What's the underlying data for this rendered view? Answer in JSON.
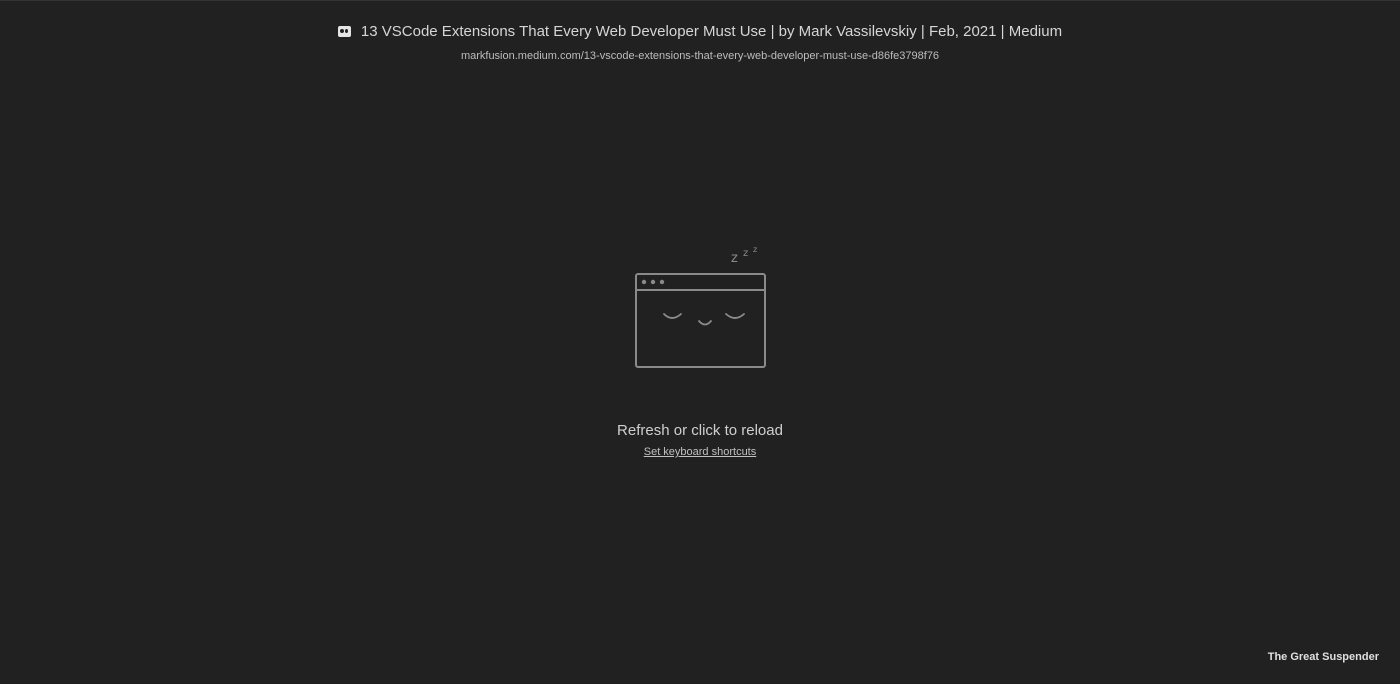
{
  "page": {
    "title": "13 VSCode Extensions That Every Web Developer Must Use | by Mark Vassilevskiy | Feb, 2021 | Medium",
    "url": "markfusion.medium.com/13-vscode-extensions-that-every-web-developer-must-use-d86fe3798f76",
    "favicon": "medium-favicon-icon"
  },
  "illustration": {
    "icon": "sleeping-browser-icon",
    "zzz": [
      "z",
      "z",
      "z"
    ]
  },
  "actions": {
    "reload_text": "Refresh or click to reload",
    "shortcuts_link": "Set keyboard shortcuts"
  },
  "footer": {
    "brand": "The Great Suspender"
  },
  "colors": {
    "background": "#212121",
    "text": "#cfcfcf",
    "illustration_stroke": "#8a8a8a"
  }
}
